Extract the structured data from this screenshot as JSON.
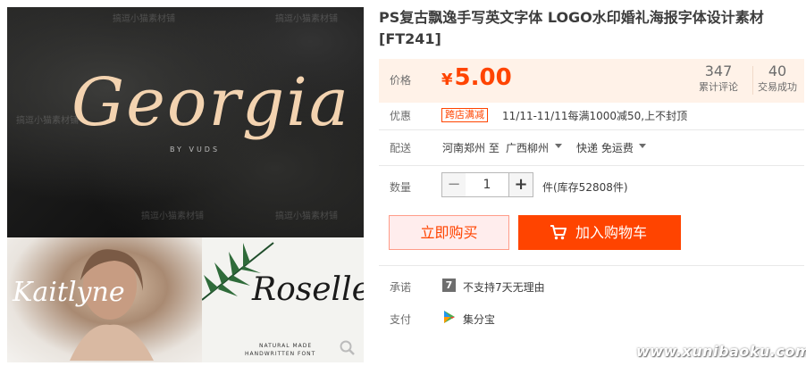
{
  "product": {
    "title": "PS复古飘逸手写英文字体 LOGO水印婚礼海报字体设计素材[FT241]"
  },
  "gallery": {
    "watermark": "搞逗小猫素材铺",
    "art_main_text": "Georgia",
    "art_sub_text": "BY VUDS",
    "art_left_text": "Kaitlyne",
    "art_right_text": "Roselle",
    "art_right_caption_1": "NATURAL MADE",
    "art_right_caption_2": "HANDWRITTEN FONT",
    "zoom_icon": "magnifier-icon"
  },
  "price": {
    "label": "价格",
    "currency": "¥",
    "amount": "5.00",
    "reviews_count": "347",
    "reviews_label": "累计评论",
    "deals_count": "40",
    "deals_label": "交易成功"
  },
  "promo": {
    "label": "优惠",
    "badge": "跨店满减",
    "text": "11/11-11/11每满1000减50,上不封顶"
  },
  "shipping": {
    "label": "配送",
    "from": "河南郑州 至",
    "to": "广西柳州",
    "method": "快递 免运费"
  },
  "quantity": {
    "label": "数量",
    "value": "1",
    "minus": "−",
    "plus": "+",
    "stock_text": "件(库存52808件)"
  },
  "actions": {
    "buy_now": "立即购买",
    "add_to_cart": "加入购物车"
  },
  "promise": {
    "label": "承诺",
    "icon_text": "7",
    "text": "不支持7天无理由"
  },
  "payment": {
    "label": "支付",
    "text": "集分宝"
  },
  "site_watermark": "www.xunibaoku.com",
  "colors": {
    "accent": "#ff4400",
    "price_bg": "#fff2e8",
    "buy_bg": "#ffeded"
  }
}
